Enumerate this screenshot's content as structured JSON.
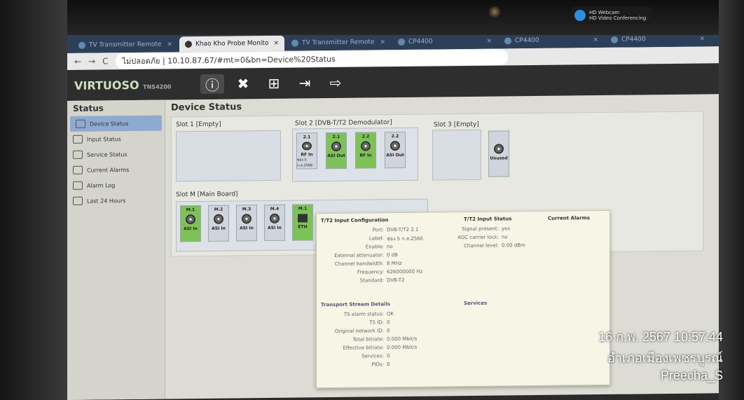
{
  "browser": {
    "tabs": [
      {
        "label": "TV Transmitter Remote",
        "active": false
      },
      {
        "label": "Khao Kho Probe Monito",
        "active": true
      },
      {
        "label": "TV Transmitter Remote",
        "active": false
      },
      {
        "label": "CP4400",
        "active": false
      },
      {
        "label": "CP4400",
        "active": false
      },
      {
        "label": "CP4400",
        "active": false
      }
    ],
    "security_label": "ไม่ปลอดภัย",
    "url": "10.10.87.67/#mt=0&bn=Device%20Status"
  },
  "app": {
    "brand": "VIRTUOSO",
    "model": "TNS4200",
    "header_icons": [
      "info-icon",
      "tools-icon",
      "network-icon",
      "login-icon",
      "logout-icon"
    ]
  },
  "sidebar": {
    "title": "Status",
    "items": [
      {
        "label": "Device Status",
        "icon": "device-status-icon",
        "active": true
      },
      {
        "label": "Input Status",
        "icon": "input-icon",
        "active": false
      },
      {
        "label": "Service Status",
        "icon": "monitor-icon",
        "active": false
      },
      {
        "label": "Current Alarms",
        "icon": "alarm-icon",
        "active": false
      },
      {
        "label": "Alarm Log",
        "icon": "log-icon",
        "active": false
      },
      {
        "label": "Last 24 Hours",
        "icon": "history-icon",
        "active": false
      }
    ]
  },
  "main": {
    "title": "Device Status",
    "slot1": {
      "label": "Slot 1 [Empty]"
    },
    "slot2": {
      "label": "Slot 2 [DVB-T/T2 Demodulator]",
      "ports": [
        {
          "num": "2.1",
          "name": "RF In",
          "sub": "ช่อง 5 ก.ล.2566",
          "green": false
        },
        {
          "num": "2.1",
          "name": "ASI Out",
          "sub": "",
          "green": true
        },
        {
          "num": "2.2",
          "name": "RF In",
          "sub": "",
          "green": true
        },
        {
          "num": "2.2",
          "name": "ASI Out",
          "sub": "",
          "green": false
        }
      ]
    },
    "slot3": {
      "label": "Slot 3 [Empty]",
      "unused_label": "Unused"
    },
    "slotm": {
      "label": "Slot M [Main Board]",
      "ports": [
        {
          "num": "M.1",
          "name": "ASI In",
          "green": true
        },
        {
          "num": "M.2",
          "name": "ASI In",
          "green": false
        },
        {
          "num": "M.3",
          "name": "ASI In",
          "green": false
        },
        {
          "num": "M.4",
          "name": "ASI In",
          "green": false
        },
        {
          "num": "M.1",
          "name": "ETH",
          "green": true
        }
      ]
    }
  },
  "tooltip": {
    "config_title": "T/T2 Input Configuration",
    "status_title": "T/T2 Input Status",
    "alarms_title": "Current Alarms",
    "config": [
      {
        "k": "Port:",
        "v": "DVB-T/T2 2.1"
      },
      {
        "k": "Label:",
        "v": "ช่อง 5 ก.ล.2566"
      },
      {
        "k": "Enable:",
        "v": "no"
      },
      {
        "k": "External attenuator:",
        "v": "0 dB"
      },
      {
        "k": "Channel bandwidth:",
        "v": "8 MHz"
      },
      {
        "k": "Frequency:",
        "v": "626000000 Hz"
      },
      {
        "k": "Standard:",
        "v": "DVB-T2"
      }
    ],
    "status": [
      {
        "k": "Signal present:",
        "v": "yes"
      },
      {
        "k": "AGC carrier lock:",
        "v": "no"
      },
      {
        "k": "Channel level:",
        "v": "0.00 dBm"
      }
    ],
    "ts_title": "Transport Stream Details",
    "services_title": "Services",
    "ts": [
      {
        "k": "TS alarm status:",
        "v": "OK"
      },
      {
        "k": "TS ID:",
        "v": "0"
      },
      {
        "k": "Original network ID:",
        "v": "0"
      },
      {
        "k": "Total bitrate:",
        "v": "0.000 Mbit/s"
      },
      {
        "k": "Effective bitrate:",
        "v": "0.000 Mbit/s"
      },
      {
        "k": "Services:",
        "v": "0"
      },
      {
        "k": "PIDs:",
        "v": "0"
      }
    ]
  },
  "overlay": {
    "webcam_title": "HD Webcam",
    "webcam_sub": "HD Video Conferencing",
    "datetime": "16 ก.พ. 2567 10:57:44",
    "location": "อำเภอเมืองเพชรบูรณ์",
    "user": "Preecha_S"
  }
}
